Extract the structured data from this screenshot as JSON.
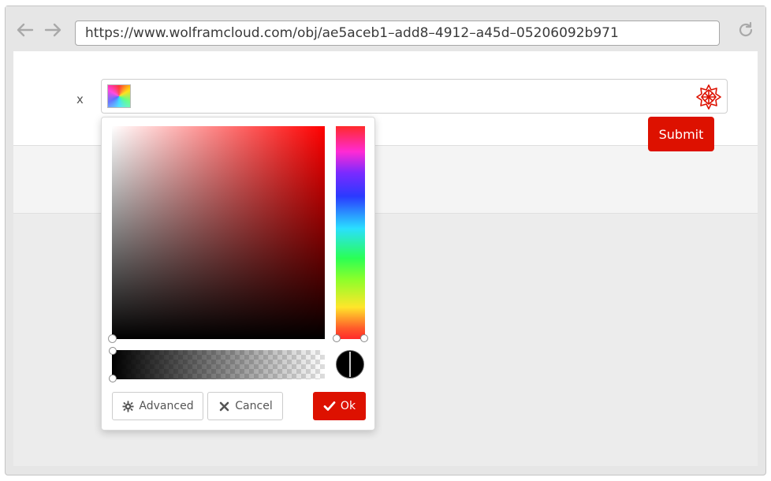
{
  "browser": {
    "url": "https://www.wolframcloud.com/obj/ae5aceb1–add8–4912–a45d–05206092b971",
    "icons": {
      "back": "arrow-left-icon",
      "forward": "arrow-right-icon",
      "reload": "reload-icon"
    }
  },
  "form": {
    "field_label": "x",
    "submit_label": "Submit",
    "accent_color": "#dd1100"
  },
  "color_picker": {
    "hue_color": "#ff0000",
    "selected_color": "#000000",
    "buttons": {
      "advanced": "Advanced",
      "cancel": "Cancel",
      "ok": "Ok"
    },
    "icons": {
      "advanced": "gear-icon",
      "cancel": "close-icon",
      "ok": "check-icon"
    }
  }
}
